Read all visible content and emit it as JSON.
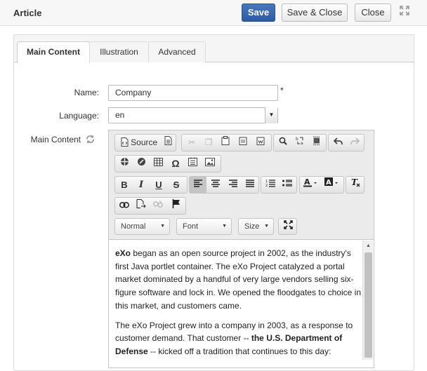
{
  "header": {
    "title": "Article",
    "save_label": "Save",
    "save_close_label": "Save & Close",
    "close_label": "Close"
  },
  "tabs": [
    {
      "label": "Main Content",
      "active": true
    },
    {
      "label": "Illustration",
      "active": false
    },
    {
      "label": "Advanced",
      "active": false
    }
  ],
  "form": {
    "name_label": "Name:",
    "name_value": "Company",
    "required_mark": "*",
    "language_label": "Language:",
    "language_value": "en",
    "main_content_label": "Main Content"
  },
  "toolbar": {
    "source_label": "Source",
    "format_value": "Normal",
    "font_value": "Font",
    "size_value": "Size"
  },
  "content": {
    "p1_bold_start": "eXo",
    "p1_rest": " began as an open source project in 2002, as the industry's first Java portlet container. The eXo Project catalyzed a portal market dominated by a handful of very large vendors selling six-figure software and lock in. We opened the floodgates to choice in this market, and customers came.",
    "p2_start": "The eXo Project grew into a company in 2003, as a response to customer demand. That customer -- ",
    "p2_bold": "the U.S. Department of Defense",
    "p2_end": " -- kicked off a tradition that continues to this day:"
  },
  "colors": {
    "primary": "#3464ac",
    "toolbar_bg": "#ebebeb"
  }
}
